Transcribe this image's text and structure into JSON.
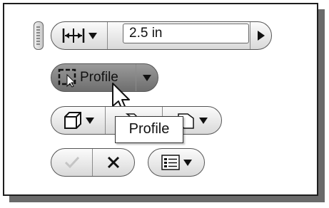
{
  "distance_row": {
    "dimension_icon": "horizontal-dimension-icon",
    "value": "2.5 in",
    "arrow_icon": "play-right-icon"
  },
  "profile_button": {
    "label": "Profile",
    "icon": "profile-select-icon"
  },
  "tooltip": {
    "text": "Profile"
  },
  "shape_row": {
    "icons": [
      "box-icon",
      "box-arrow-icon",
      "box-right-icon"
    ]
  },
  "confirm_row": {
    "ok_icon": "checkmark-icon",
    "cancel_icon": "cross-icon",
    "options_icon": "list-options-icon"
  },
  "colors": {
    "frame_border": "#1e1e1e",
    "shadow": "#6a6a6a",
    "profile_pill": "#7d7d7d"
  }
}
